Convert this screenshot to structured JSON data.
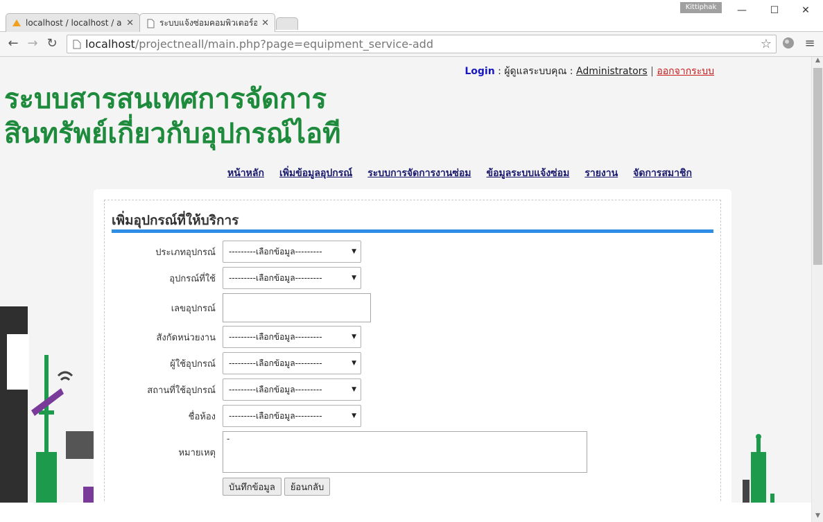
{
  "window": {
    "user_badge": "Kittiphak",
    "minimize": "—",
    "maximize": "☐",
    "close": "✕"
  },
  "tabs": [
    {
      "label": "localhost / localhost / asse",
      "favicon": "PMA"
    },
    {
      "label": "ระบบแจ้งซ่อมคอมพิวเตอร์ออนไ"
    }
  ],
  "tab_close": "✕",
  "address": {
    "host": "localhost",
    "path": "/projectneall/main.php?page=equipment_service-add"
  },
  "header": {
    "login_label": "Login",
    "admin_prefix": ": ผู้ดูแลระบบคุณ :",
    "admin_name": "Administrators",
    "separator": "|",
    "logout": "ออกจากระบบ",
    "title_line1": "ระบบสารสนเทศการจัดการ",
    "title_line2": "สินทรัพย์เกี่ยวกับอุปกรณ์ไอที"
  },
  "menu": [
    "หน้าหลัก",
    "เพิ่มข้อมูลอุปกรณ์",
    "ระบบการจัดการงานซ่อม",
    "ข้อมูลระบบแจ้งซ่อม",
    "รายงาน",
    "จัดการสมาชิก"
  ],
  "form": {
    "title": "เพิ่มอุปกรณ์ที่ให้บริการ",
    "select_placeholder": "---------เลือกข้อมูล---------",
    "fields": {
      "equipment_type": "ประเภทอุปกรณ์",
      "equipment_used": "อุปกรณ์ที่ใช้",
      "equipment_number": "เลขอุปกรณ์",
      "department": "สังกัดหน่วยงาน",
      "user": "ผู้ใช้อุปกรณ์",
      "location": "สถานที่ใช้อุปกรณ์",
      "room": "ชื่อห้อง",
      "note": "หมายเหตุ"
    },
    "note_value": "-",
    "save_label": "บันทึกข้อมูล",
    "back_label": "ย้อนกลับ"
  },
  "colors": {
    "title_green": "#1e8a3c",
    "menu_link": "#1a1a6e",
    "rule_blue": "#2e8ee6",
    "logout_red": "#c81818",
    "login_blue": "#1717c0"
  }
}
